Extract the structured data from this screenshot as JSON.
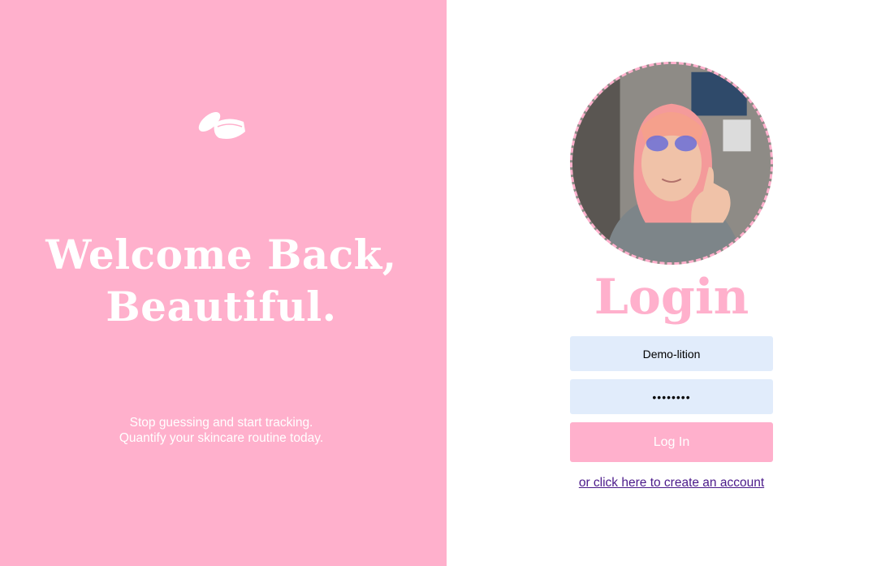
{
  "brand": {
    "logo_icon": "skincare-jar-icon",
    "accent_color": "#ffb0cc"
  },
  "left_panel": {
    "headline_line1": "Welcome Back,",
    "headline_line2": "Beautiful.",
    "tagline_line1": "Stop guessing and start tracking.",
    "tagline_line2": "Quantify your skincare routine today."
  },
  "login_form": {
    "avatar_icon": "profile-photo",
    "title": "Login",
    "username_value": "Demo-lition",
    "password_value": "demo1234",
    "submit_label": "Log In",
    "create_account_link": "or click here to create an account",
    "input_background": "#e1ecfb",
    "link_color": "#4b1a8a"
  }
}
